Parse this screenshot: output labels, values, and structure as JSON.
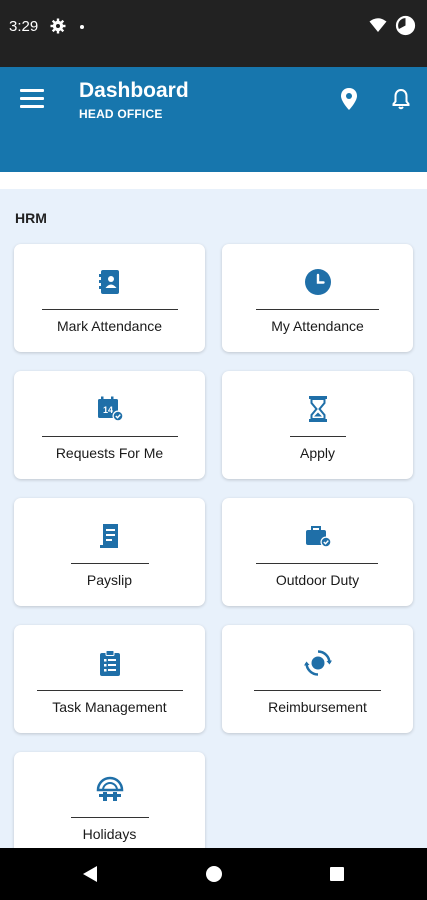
{
  "status_bar": {
    "time": "3:29"
  },
  "app_bar": {
    "title": "Dashboard",
    "subtitle": "HEAD OFFICE"
  },
  "section": {
    "label": "HRM"
  },
  "cards": [
    {
      "label": "Mark Attendance",
      "icon": "contact-book-icon"
    },
    {
      "label": "My Attendance",
      "icon": "clock-icon"
    },
    {
      "label": "Requests For Me",
      "icon": "calendar-check-icon"
    },
    {
      "label": "Apply",
      "icon": "hourglass-icon"
    },
    {
      "label": "Payslip",
      "icon": "document-icon"
    },
    {
      "label": "Outdoor Duty",
      "icon": "briefcase-check-icon"
    },
    {
      "label": "Task Management",
      "icon": "clipboard-list-icon"
    },
    {
      "label": "Reimbursement",
      "icon": "refresh-coin-icon"
    },
    {
      "label": "Holidays",
      "icon": "beach-umbrella-icon"
    }
  ],
  "colors": {
    "brand": "#1776ad",
    "icon": "#1f6fa8",
    "background": "#e8f1fb"
  }
}
